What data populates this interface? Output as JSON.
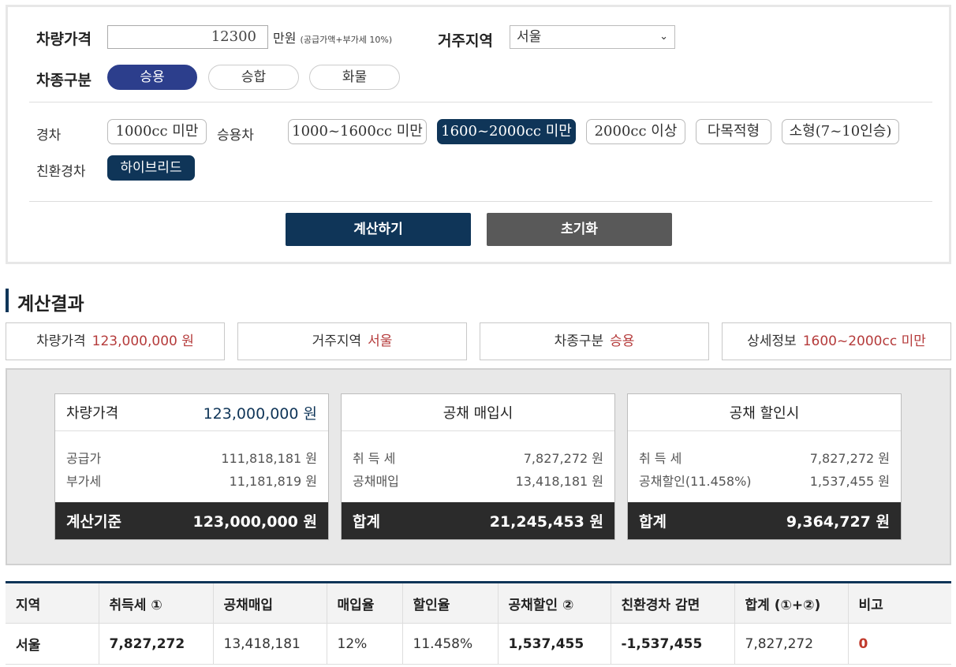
{
  "form": {
    "price_label": "차량가격",
    "price_value": "12300",
    "price_unit": "만원",
    "price_note": "(공급가액+부가세 10%)",
    "region_label": "거주지역",
    "region_selected": "서울",
    "type_label": "차종구분",
    "type_options": [
      "승용",
      "승합",
      "화물"
    ],
    "type_selected": "승용",
    "light_label": "경차",
    "light_option": "1000cc 미만",
    "passenger_label": "승용차",
    "passenger_options": [
      "1000~1600cc 미만",
      "1600~2000cc 미만",
      "2000cc 이상",
      "다목적형",
      "소형(7~10인승)"
    ],
    "passenger_selected": "1600~2000cc 미만",
    "eco_label": "친환경차",
    "eco_option": "하이브리드",
    "calc_button": "계산하기",
    "reset_button": "초기화"
  },
  "result": {
    "title": "계산결과",
    "summary": [
      {
        "label": "차량가격",
        "value": "123,000,000 원"
      },
      {
        "label": "거주지역",
        "value": "서울"
      },
      {
        "label": "차종구분",
        "value": "승용"
      },
      {
        "label": "상세정보",
        "value": "1600~2000cc 미만"
      }
    ],
    "cards": {
      "price": {
        "head_label": "차량가격",
        "head_value": "123,000,000 원",
        "rows": [
          {
            "label": "공급가",
            "value": "111,818,181 원"
          },
          {
            "label": "부가세",
            "value": "11,181,819 원"
          }
        ],
        "foot_label": "계산기준",
        "foot_value": "123,000,000 원"
      },
      "purchase": {
        "head_label": "공채 매입시",
        "rows": [
          {
            "label": "취 득 세",
            "value": "7,827,272 원"
          },
          {
            "label": "공채매입",
            "value": "13,418,181 원"
          }
        ],
        "foot_label": "합계",
        "foot_value": "21,245,453 원"
      },
      "discount": {
        "head_label": "공채 할인시",
        "rows": [
          {
            "label": "취 득 세",
            "value": "7,827,272 원"
          },
          {
            "label": "공채할인(11.458%)",
            "value": "1,537,455 원"
          }
        ],
        "foot_label": "합계",
        "foot_value": "9,364,727 원"
      }
    },
    "table": {
      "headers": [
        "지역",
        "취득세 ①",
        "공채매입",
        "매입율",
        "할인율",
        "공채할인 ②",
        "친환경차 감면",
        "합계 (①+②)",
        "비고"
      ],
      "row": [
        "서울",
        "7,827,272",
        "13,418,181",
        "12%",
        "11.458%",
        "1,537,455",
        "-1,537,455",
        "7,827,272",
        "0"
      ]
    }
  }
}
